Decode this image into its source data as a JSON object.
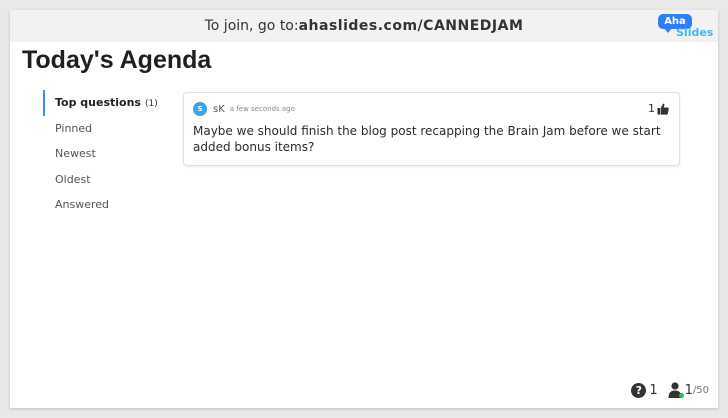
{
  "topbar": {
    "prefix": "To join, go to: ",
    "url": "ahaslides.com/CANNEDJAM"
  },
  "logo": {
    "word1": "Aha",
    "word2": "Slides"
  },
  "page": {
    "title": "Today's Agenda"
  },
  "sidebar": {
    "items": [
      {
        "label": "Top questions",
        "count": "(1)"
      },
      {
        "label": "Pinned"
      },
      {
        "label": "Newest"
      },
      {
        "label": "Oldest"
      },
      {
        "label": "Answered"
      }
    ]
  },
  "question": {
    "avatar_letter": "S",
    "author": "sK",
    "time": "a few seconds ago",
    "likes": "1",
    "text": "Maybe we should finish the blog post recapping the Brain Jam before we start added bonus items?"
  },
  "footer": {
    "question_count": "1",
    "participants": "1",
    "capacity": "/50"
  },
  "icons": {
    "like": "thumbs-up-icon",
    "question": "question-circle-icon",
    "participants": "person-icon"
  },
  "colors": {
    "accent": "#3a8fe0",
    "avatar": "#3aa4e9",
    "online": "#2ebd59",
    "logo_blue": "#2d7ff9"
  }
}
